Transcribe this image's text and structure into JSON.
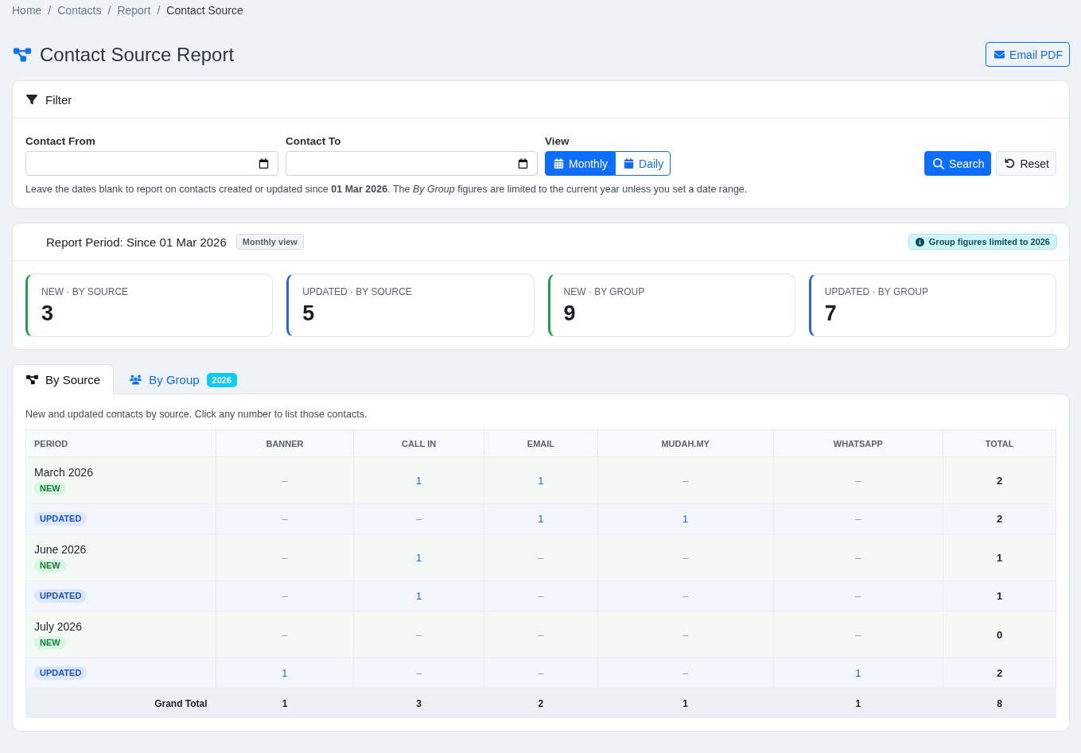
{
  "breadcrumb": {
    "separator": "/",
    "items": [
      {
        "label": "Home",
        "current": false
      },
      {
        "label": "Contacts",
        "current": false
      },
      {
        "label": "Report",
        "current": false
      },
      {
        "label": "Contact Source",
        "current": true
      }
    ]
  },
  "page": {
    "title": "Contact Source Report",
    "email_button": "Email PDF"
  },
  "filter": {
    "title": "Filter",
    "fields": [
      {
        "label": "Contact From"
      },
      {
        "label": "Contact To"
      }
    ],
    "view": {
      "label": "View",
      "options": [
        {
          "label": "Monthly",
          "selected": true
        },
        {
          "label": "Daily",
          "selected": false
        }
      ]
    },
    "search_button": "Search",
    "reset_button": "Reset",
    "hint": "Leave the dates blank to report on contacts created or updated since **01 Mar 2026**. The *By Group* figures are limited to the current year unless you set a date range."
  },
  "report_period": {
    "title": "Report Period: Since 01 Mar 2026",
    "view_badge": "Monthly view",
    "notice": "Group figures limited to 2026"
  },
  "stats": [
    {
      "label": "NEW · BY SOURCE",
      "value": "3",
      "kind": "new"
    },
    {
      "label": "UPDATED · BY SOURCE",
      "value": "5",
      "kind": "updated"
    },
    {
      "label": "NEW · BY GROUP",
      "value": "9",
      "kind": "new"
    },
    {
      "label": "UPDATED · BY GROUP",
      "value": "7",
      "kind": "updated"
    }
  ],
  "tabs": [
    {
      "label": "By Source",
      "selected": true
    },
    {
      "label": "By Group",
      "badge": "2026",
      "selected": false
    }
  ],
  "table": {
    "caption": "New and updated contacts by source. Click any number to list those contacts.",
    "columns": [
      "PERIOD",
      "BANNER",
      "CALL IN",
      "EMAIL",
      "MUDAH.MY",
      "WHATSAPP",
      "TOTAL"
    ],
    "rows": [
      {
        "kind": "new",
        "cells": [
          {
            "kind": "period",
            "period": "March 2026",
            "tag": "NEW"
          },
          {
            "kind": "count",
            "text": "–",
            "link": false
          },
          {
            "kind": "count",
            "text": "1",
            "link": true
          },
          {
            "kind": "count",
            "text": "1",
            "link": true
          },
          {
            "kind": "count",
            "text": "–",
            "link": false
          },
          {
            "kind": "count",
            "text": "–",
            "link": false
          },
          {
            "kind": "total",
            "text": "2"
          }
        ]
      },
      {
        "kind": "updated",
        "cells": [
          {
            "kind": "period",
            "tag": "UPDATED"
          },
          {
            "kind": "count",
            "text": "–",
            "link": false
          },
          {
            "kind": "count",
            "text": "–",
            "link": false
          },
          {
            "kind": "count",
            "text": "1",
            "link": true
          },
          {
            "kind": "count",
            "text": "1",
            "link": true
          },
          {
            "kind": "count",
            "text": "–",
            "link": false
          },
          {
            "kind": "total",
            "text": "2"
          }
        ]
      },
      {
        "kind": "new",
        "cells": [
          {
            "kind": "period",
            "period": "June 2026",
            "tag": "NEW"
          },
          {
            "kind": "count",
            "text": "–",
            "link": false
          },
          {
            "kind": "count",
            "text": "1",
            "link": true
          },
          {
            "kind": "count",
            "text": "–",
            "link": false
          },
          {
            "kind": "count",
            "text": "–",
            "link": false
          },
          {
            "kind": "count",
            "text": "–",
            "link": false
          },
          {
            "kind": "total",
            "text": "1"
          }
        ]
      },
      {
        "kind": "updated",
        "cells": [
          {
            "kind": "period",
            "tag": "UPDATED"
          },
          {
            "kind": "count",
            "text": "–",
            "link": false
          },
          {
            "kind": "count",
            "text": "1",
            "link": true
          },
          {
            "kind": "count",
            "text": "–",
            "link": false
          },
          {
            "kind": "count",
            "text": "–",
            "link": false
          },
          {
            "kind": "count",
            "text": "–",
            "link": false
          },
          {
            "kind": "total",
            "text": "1"
          }
        ]
      },
      {
        "kind": "new",
        "cells": [
          {
            "kind": "period",
            "period": "July 2026",
            "tag": "NEW"
          },
          {
            "kind": "count",
            "text": "–",
            "link": false
          },
          {
            "kind": "count",
            "text": "–",
            "link": false
          },
          {
            "kind": "count",
            "text": "–",
            "link": false
          },
          {
            "kind": "count",
            "text": "–",
            "link": false
          },
          {
            "kind": "count",
            "text": "–",
            "link": false
          },
          {
            "kind": "total",
            "text": "0"
          }
        ]
      },
      {
        "kind": "updated",
        "cells": [
          {
            "kind": "period",
            "tag": "UPDATED"
          },
          {
            "kind": "count",
            "text": "1",
            "link": true
          },
          {
            "kind": "count",
            "text": "–",
            "link": false
          },
          {
            "kind": "count",
            "text": "–",
            "link": false
          },
          {
            "kind": "count",
            "text": "–",
            "link": false
          },
          {
            "kind": "count",
            "text": "1",
            "link": true
          },
          {
            "kind": "total",
            "text": "2"
          }
        ]
      }
    ],
    "footer": {
      "cells": [
        {
          "kind": "label",
          "text": "Grand Total"
        },
        {
          "kind": "total",
          "text": "1"
        },
        {
          "kind": "total",
          "text": "3"
        },
        {
          "kind": "total",
          "text": "2"
        },
        {
          "kind": "total",
          "text": "1"
        },
        {
          "kind": "total",
          "text": "1"
        },
        {
          "kind": "total",
          "text": "8"
        }
      ]
    }
  }
}
